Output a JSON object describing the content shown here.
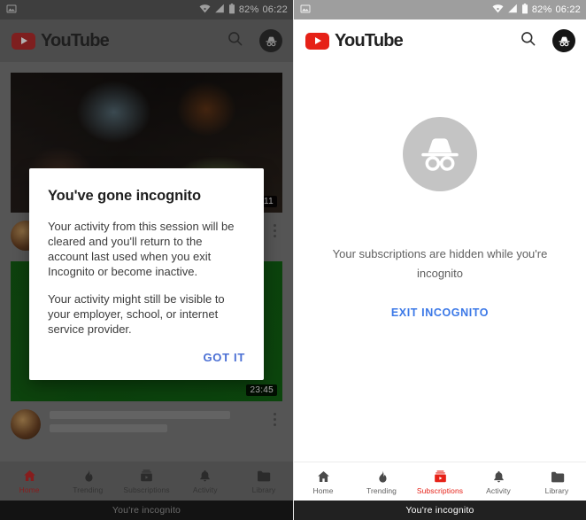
{
  "statusbar": {
    "notification_icon": "image-icon",
    "wifi_icon": "wifi-icon",
    "signal_icon": "signal-icon",
    "battery_icon": "battery-icon",
    "battery_percent": "82%",
    "time": "06:22"
  },
  "appbar": {
    "logo_text": "YouTube",
    "search_icon": "search-icon",
    "account_icon": "incognito-avatar-icon"
  },
  "colors": {
    "brand_red": "#e62117",
    "link_blue": "#4a6fd4",
    "exit_link_blue": "#3b78e7",
    "incognito_circle_gray": "#c4c4c4",
    "dim_overlay": "rgba(0,0,0,0.30)"
  },
  "left_panel": {
    "feed": {
      "cards": [
        {
          "duration": "11",
          "thumbnail": "conference-stage-thumbnail",
          "avatar": "channel-avatar"
        },
        {
          "duration": "23:45",
          "thumbnail": "green-screen-craft-thumbnail",
          "avatar": "channel-avatar"
        }
      ],
      "overflow_icon": "kebab-menu-icon"
    },
    "dialog": {
      "title": "You've gone incognito",
      "paragraph_1": "Your activity from this session will be cleared and you'll return to the account last used when you exit Incognito or become inactive.",
      "paragraph_2": "Your activity might still be visible to your employer, school, or internet service provider.",
      "confirm_label": "GOT IT"
    },
    "bottom_nav": {
      "active": "Home",
      "items": [
        {
          "label": "Home",
          "icon": "home-icon"
        },
        {
          "label": "Trending",
          "icon": "trending-flame-icon"
        },
        {
          "label": "Subscriptions",
          "icon": "subscriptions-icon"
        },
        {
          "label": "Activity",
          "icon": "bell-icon"
        },
        {
          "label": "Library",
          "icon": "library-folder-icon"
        }
      ]
    },
    "incognito_banner": "You're incognito"
  },
  "right_panel": {
    "empty_state": {
      "icon": "incognito-hat-glasses-icon",
      "message": "Your subscriptions are hidden while you're incognito",
      "action_label": "EXIT INCOGNITO"
    },
    "bottom_nav": {
      "active": "Subscriptions",
      "items": [
        {
          "label": "Home",
          "icon": "home-icon"
        },
        {
          "label": "Trending",
          "icon": "trending-flame-icon"
        },
        {
          "label": "Subscriptions",
          "icon": "subscriptions-icon"
        },
        {
          "label": "Activity",
          "icon": "bell-icon"
        },
        {
          "label": "Library",
          "icon": "library-folder-icon"
        }
      ]
    },
    "incognito_banner": "You're incognito"
  }
}
